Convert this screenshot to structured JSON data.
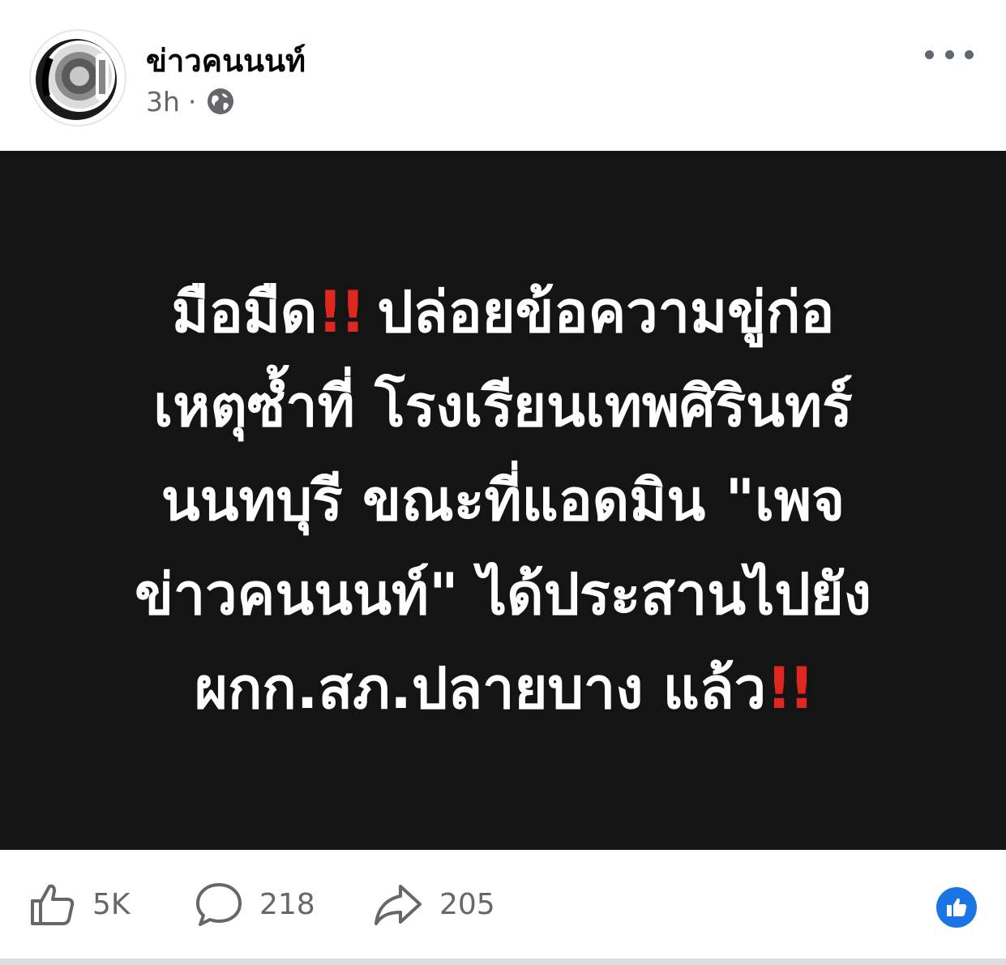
{
  "header": {
    "page_name": "ข่าวคนนนท์",
    "time": "3h",
    "separator": "·",
    "privacy_icon": "globe-icon",
    "more_icon": "more-horizontal-icon"
  },
  "post": {
    "background": "#141414",
    "text_color": "#ffffff",
    "accent_color": "#e0271f",
    "emphasis_glyph": "!!",
    "lines": [
      {
        "before": "มือมืด",
        "bang": true,
        "after": "ปล่อยข้อความขู่ก่อ"
      },
      {
        "before": "เหตุซ้ำที่ โรงเรียนเทพศิรินทร์",
        "bang": false,
        "after": ""
      },
      {
        "before": "นนทบุรี ขณะที่แอดมิน \"เพจ",
        "bang": false,
        "after": ""
      },
      {
        "before": "ข่าวคนนนท์\" ได้ประสานไปยัง",
        "bang": false,
        "after": ""
      },
      {
        "before": "ผกก.สภ.ปลายบาง แล้ว",
        "bang": true,
        "after": ""
      }
    ]
  },
  "actions": {
    "like": {
      "icon": "thumbs-up-icon",
      "count": "5K"
    },
    "comment": {
      "icon": "comment-icon",
      "count": "218"
    },
    "share": {
      "icon": "share-icon",
      "count": "205"
    },
    "reaction_icon": "like-reaction-icon",
    "reaction_color": "#1b74e4"
  }
}
